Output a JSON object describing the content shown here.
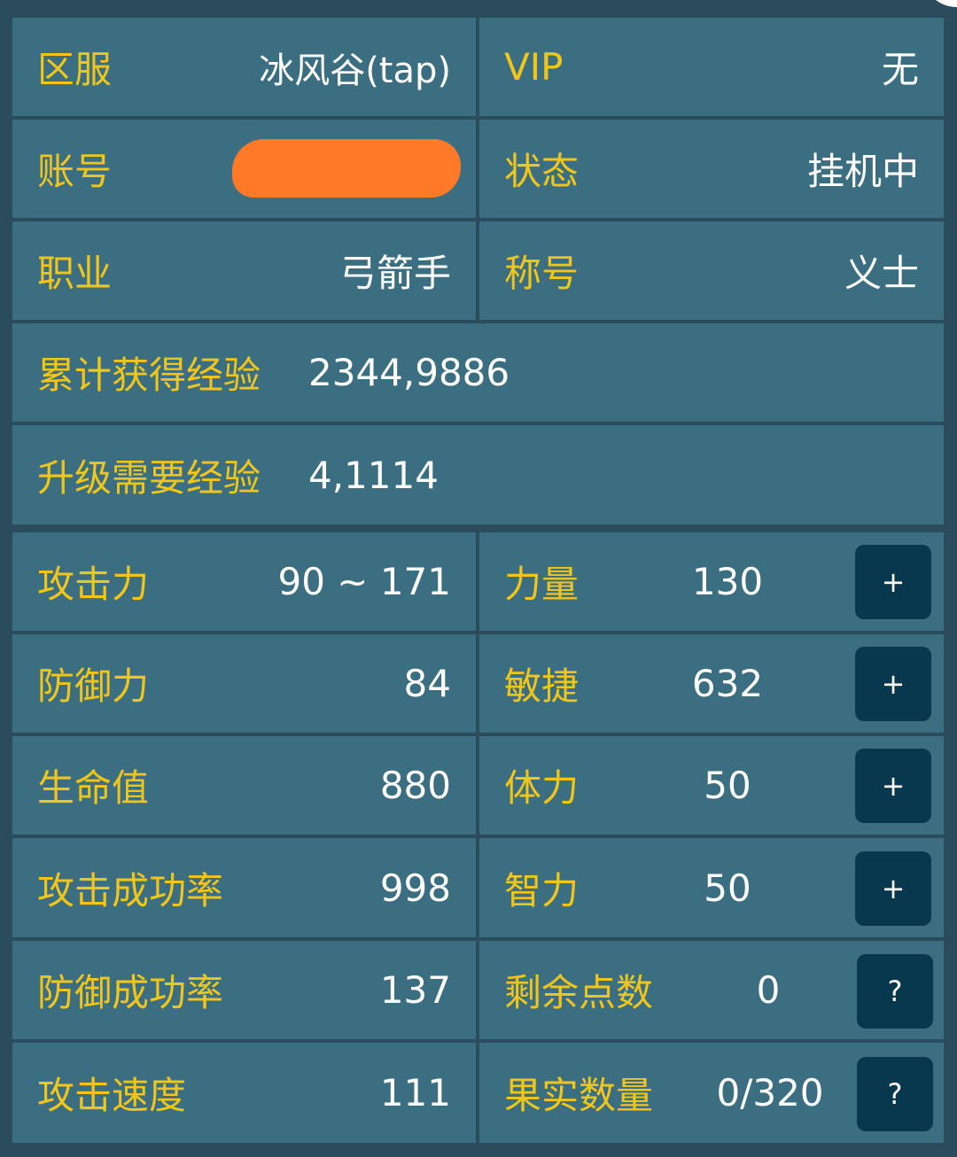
{
  "info": {
    "server_label": "区服",
    "server_value": "冰风谷(tap)",
    "vip_label": "VIP",
    "vip_value": "无",
    "account_label": "账号",
    "status_label": "状态",
    "status_value": "挂机中",
    "class_label": "职业",
    "class_value": "弓箭手",
    "title_label": "称号",
    "title_value": "义士",
    "total_exp_label": "累计获得经验",
    "total_exp_value": "2344,9886",
    "level_exp_label": "升级需要经验",
    "level_exp_value": "4,1114"
  },
  "stats": {
    "attack_label": "攻击力",
    "attack_value": "90 ~ 171",
    "defense_label": "防御力",
    "defense_value": "84",
    "hp_label": "生命值",
    "hp_value": "880",
    "hit_rate_label": "攻击成功率",
    "hit_rate_value": "998",
    "block_rate_label": "防御成功率",
    "block_rate_value": "137",
    "attack_speed_label": "攻击速度",
    "attack_speed_value": "111"
  },
  "attributes": {
    "strength_label": "力量",
    "strength_value": "130",
    "agility_label": "敏捷",
    "agility_value": "632",
    "stamina_label": "体力",
    "stamina_value": "50",
    "intelligence_label": "智力",
    "intelligence_value": "50",
    "remaining_points_label": "剩余点数",
    "remaining_points_value": "0",
    "fruit_count_label": "果实数量",
    "fruit_count_value": "0/320",
    "plus_label": "+",
    "help_label": "?"
  },
  "colors": {
    "label": "#f0c61c",
    "value": "#ffffff",
    "cell": "#3b6e80",
    "border": "#2a4c5d",
    "button": "#08384d",
    "redaction": "#ff7a28"
  }
}
